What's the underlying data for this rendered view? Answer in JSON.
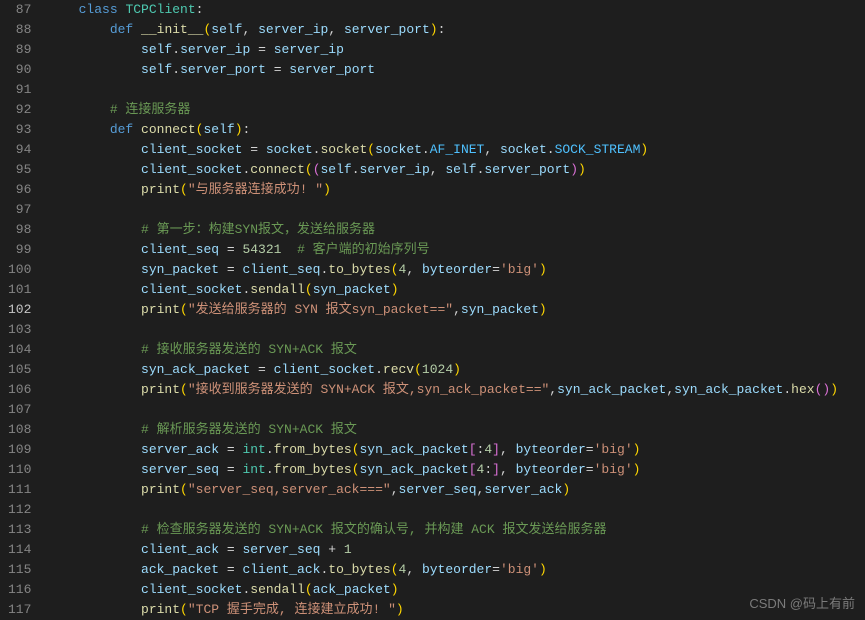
{
  "line_start": 87,
  "line_end": 117,
  "current_line": 102,
  "watermark": "CSDN @码上有前",
  "code_lines": {
    "l87": {
      "indent": 1,
      "tokens": [
        [
          "kw",
          "class"
        ],
        [
          "sp",
          " "
        ],
        [
          "cls",
          "TCPClient"
        ],
        [
          "pn",
          ":"
        ]
      ]
    },
    "l88": {
      "indent": 2,
      "tokens": [
        [
          "kwdef",
          "def"
        ],
        [
          "sp",
          " "
        ],
        [
          "fn",
          "__init__"
        ],
        [
          "brk",
          "("
        ],
        [
          "slf",
          "self"
        ],
        [
          "pn",
          ", "
        ],
        [
          "param",
          "server_ip"
        ],
        [
          "pn",
          ", "
        ],
        [
          "param",
          "server_port"
        ],
        [
          "brk",
          ")"
        ],
        [
          "pn",
          ":"
        ]
      ]
    },
    "l89": {
      "indent": 3,
      "tokens": [
        [
          "slf",
          "self"
        ],
        [
          "pn",
          "."
        ],
        [
          "prop",
          "server_ip"
        ],
        [
          "op",
          " = "
        ],
        [
          "var",
          "server_ip"
        ]
      ]
    },
    "l90": {
      "indent": 3,
      "tokens": [
        [
          "slf",
          "self"
        ],
        [
          "pn",
          "."
        ],
        [
          "prop",
          "server_port"
        ],
        [
          "op",
          " = "
        ],
        [
          "var",
          "server_port"
        ]
      ]
    },
    "l91": {
      "indent": 0,
      "tokens": []
    },
    "l92": {
      "indent": 2,
      "tokens": [
        [
          "cmt",
          "# 连接服务器"
        ]
      ]
    },
    "l93": {
      "indent": 2,
      "tokens": [
        [
          "kwdef",
          "def"
        ],
        [
          "sp",
          " "
        ],
        [
          "fn",
          "connect"
        ],
        [
          "brk",
          "("
        ],
        [
          "slf",
          "self"
        ],
        [
          "brk",
          ")"
        ],
        [
          "pn",
          ":"
        ]
      ]
    },
    "l94": {
      "indent": 3,
      "tokens": [
        [
          "var",
          "client_socket"
        ],
        [
          "op",
          " = "
        ],
        [
          "var",
          "socket"
        ],
        [
          "pn",
          "."
        ],
        [
          "fn",
          "socket"
        ],
        [
          "brk",
          "("
        ],
        [
          "var",
          "socket"
        ],
        [
          "pn",
          "."
        ],
        [
          "const",
          "AF_INET"
        ],
        [
          "pn",
          ", "
        ],
        [
          "var",
          "socket"
        ],
        [
          "pn",
          "."
        ],
        [
          "const",
          "SOCK_STREAM"
        ],
        [
          "brk",
          ")"
        ]
      ]
    },
    "l95": {
      "indent": 3,
      "tokens": [
        [
          "var",
          "client_socket"
        ],
        [
          "pn",
          "."
        ],
        [
          "fn",
          "connect"
        ],
        [
          "brk",
          "("
        ],
        [
          "brk2",
          "("
        ],
        [
          "slf",
          "self"
        ],
        [
          "pn",
          "."
        ],
        [
          "prop",
          "server_ip"
        ],
        [
          "pn",
          ", "
        ],
        [
          "slf",
          "self"
        ],
        [
          "pn",
          "."
        ],
        [
          "prop",
          "server_port"
        ],
        [
          "brk2",
          ")"
        ],
        [
          "brk",
          ")"
        ]
      ]
    },
    "l96": {
      "indent": 3,
      "tokens": [
        [
          "fn",
          "print"
        ],
        [
          "brk",
          "("
        ],
        [
          "str",
          "\"与服务器连接成功! \""
        ],
        [
          "brk",
          ")"
        ]
      ]
    },
    "l97": {
      "indent": 0,
      "tokens": []
    },
    "l98": {
      "indent": 3,
      "tokens": [
        [
          "cmt",
          "# 第一步：构建SYN报文，发送给服务器"
        ]
      ]
    },
    "l99": {
      "indent": 3,
      "tokens": [
        [
          "var",
          "client_seq"
        ],
        [
          "op",
          " = "
        ],
        [
          "num",
          "54321"
        ],
        [
          "sp",
          "  "
        ],
        [
          "cmt",
          "# 客户端的初始序列号"
        ]
      ]
    },
    "l100": {
      "indent": 3,
      "tokens": [
        [
          "var",
          "syn_packet"
        ],
        [
          "op",
          " = "
        ],
        [
          "var",
          "client_seq"
        ],
        [
          "pn",
          "."
        ],
        [
          "fn",
          "to_bytes"
        ],
        [
          "brk",
          "("
        ],
        [
          "num",
          "4"
        ],
        [
          "pn",
          ", "
        ],
        [
          "param",
          "byteorder"
        ],
        [
          "op",
          "="
        ],
        [
          "str",
          "'big'"
        ],
        [
          "brk",
          ")"
        ]
      ]
    },
    "l101": {
      "indent": 3,
      "tokens": [
        [
          "var",
          "client_socket"
        ],
        [
          "pn",
          "."
        ],
        [
          "fn",
          "sendall"
        ],
        [
          "brk",
          "("
        ],
        [
          "var",
          "syn_packet"
        ],
        [
          "brk",
          ")"
        ]
      ]
    },
    "l102": {
      "indent": 3,
      "tokens": [
        [
          "fn",
          "print"
        ],
        [
          "brk",
          "("
        ],
        [
          "str",
          "\"发送给服务器的 SYN 报文syn_packet==\""
        ],
        [
          "pn",
          ","
        ],
        [
          "var",
          "syn_packet"
        ],
        [
          "brk",
          ")"
        ]
      ]
    },
    "l103": {
      "indent": 0,
      "tokens": []
    },
    "l104": {
      "indent": 3,
      "tokens": [
        [
          "cmt",
          "# 接收服务器发送的 SYN+ACK 报文"
        ]
      ]
    },
    "l105": {
      "indent": 3,
      "tokens": [
        [
          "var",
          "syn_ack_packet"
        ],
        [
          "op",
          " = "
        ],
        [
          "var",
          "client_socket"
        ],
        [
          "pn",
          "."
        ],
        [
          "fn",
          "recv"
        ],
        [
          "brk",
          "("
        ],
        [
          "num",
          "1024"
        ],
        [
          "brk",
          ")"
        ]
      ]
    },
    "l106": {
      "indent": 3,
      "tokens": [
        [
          "fn",
          "print"
        ],
        [
          "brk",
          "("
        ],
        [
          "str",
          "\"接收到服务器发送的 SYN+ACK 报文,syn_ack_packet==\""
        ],
        [
          "pn",
          ","
        ],
        [
          "var",
          "syn_ack_packet"
        ],
        [
          "pn",
          ","
        ],
        [
          "var",
          "syn_ack_packet"
        ],
        [
          "pn",
          "."
        ],
        [
          "fn",
          "hex"
        ],
        [
          "brk2",
          "()"
        ],
        [
          "brk",
          ")"
        ]
      ]
    },
    "l107": {
      "indent": 0,
      "tokens": []
    },
    "l108": {
      "indent": 3,
      "tokens": [
        [
          "cmt",
          "# 解析服务器发送的 SYN+ACK 报文"
        ]
      ]
    },
    "l109": {
      "indent": 3,
      "tokens": [
        [
          "var",
          "server_ack"
        ],
        [
          "op",
          " = "
        ],
        [
          "cls",
          "int"
        ],
        [
          "pn",
          "."
        ],
        [
          "fn",
          "from_bytes"
        ],
        [
          "brk",
          "("
        ],
        [
          "var",
          "syn_ack_packet"
        ],
        [
          "brk2",
          "["
        ],
        [
          "pn",
          ":"
        ],
        [
          "num",
          "4"
        ],
        [
          "brk2",
          "]"
        ],
        [
          "pn",
          ", "
        ],
        [
          "param",
          "byteorder"
        ],
        [
          "op",
          "="
        ],
        [
          "str",
          "'big'"
        ],
        [
          "brk",
          ")"
        ]
      ]
    },
    "l110": {
      "indent": 3,
      "tokens": [
        [
          "var",
          "server_seq"
        ],
        [
          "op",
          " = "
        ],
        [
          "cls",
          "int"
        ],
        [
          "pn",
          "."
        ],
        [
          "fn",
          "from_bytes"
        ],
        [
          "brk",
          "("
        ],
        [
          "var",
          "syn_ack_packet"
        ],
        [
          "brk2",
          "["
        ],
        [
          "num",
          "4"
        ],
        [
          "pn",
          ":"
        ],
        [
          "brk2",
          "]"
        ],
        [
          "pn",
          ", "
        ],
        [
          "param",
          "byteorder"
        ],
        [
          "op",
          "="
        ],
        [
          "str",
          "'big'"
        ],
        [
          "brk",
          ")"
        ]
      ]
    },
    "l111": {
      "indent": 3,
      "tokens": [
        [
          "fn",
          "print"
        ],
        [
          "brk",
          "("
        ],
        [
          "str",
          "\"server_seq,server_ack===\""
        ],
        [
          "pn",
          ","
        ],
        [
          "var",
          "server_seq"
        ],
        [
          "pn",
          ","
        ],
        [
          "var",
          "server_ack"
        ],
        [
          "brk",
          ")"
        ]
      ]
    },
    "l112": {
      "indent": 0,
      "tokens": []
    },
    "l113": {
      "indent": 3,
      "tokens": [
        [
          "cmt",
          "# 检查服务器发送的 SYN+ACK 报文的确认号, 并构建 ACK 报文发送给服务器"
        ]
      ]
    },
    "l114": {
      "indent": 3,
      "tokens": [
        [
          "var",
          "client_ack"
        ],
        [
          "op",
          " = "
        ],
        [
          "var",
          "server_seq"
        ],
        [
          "op",
          " + "
        ],
        [
          "num",
          "1"
        ]
      ]
    },
    "l115": {
      "indent": 3,
      "tokens": [
        [
          "var",
          "ack_packet"
        ],
        [
          "op",
          " = "
        ],
        [
          "var",
          "client_ack"
        ],
        [
          "pn",
          "."
        ],
        [
          "fn",
          "to_bytes"
        ],
        [
          "brk",
          "("
        ],
        [
          "num",
          "4"
        ],
        [
          "pn",
          ", "
        ],
        [
          "param",
          "byteorder"
        ],
        [
          "op",
          "="
        ],
        [
          "str",
          "'big'"
        ],
        [
          "brk",
          ")"
        ]
      ]
    },
    "l116": {
      "indent": 3,
      "tokens": [
        [
          "var",
          "client_socket"
        ],
        [
          "pn",
          "."
        ],
        [
          "fn",
          "sendall"
        ],
        [
          "brk",
          "("
        ],
        [
          "var",
          "ack_packet"
        ],
        [
          "brk",
          ")"
        ]
      ]
    },
    "l117": {
      "indent": 3,
      "tokens": [
        [
          "fn",
          "print"
        ],
        [
          "brk",
          "("
        ],
        [
          "str",
          "\"TCP 握手完成, 连接建立成功! \""
        ],
        [
          "brk",
          ")"
        ]
      ]
    }
  }
}
